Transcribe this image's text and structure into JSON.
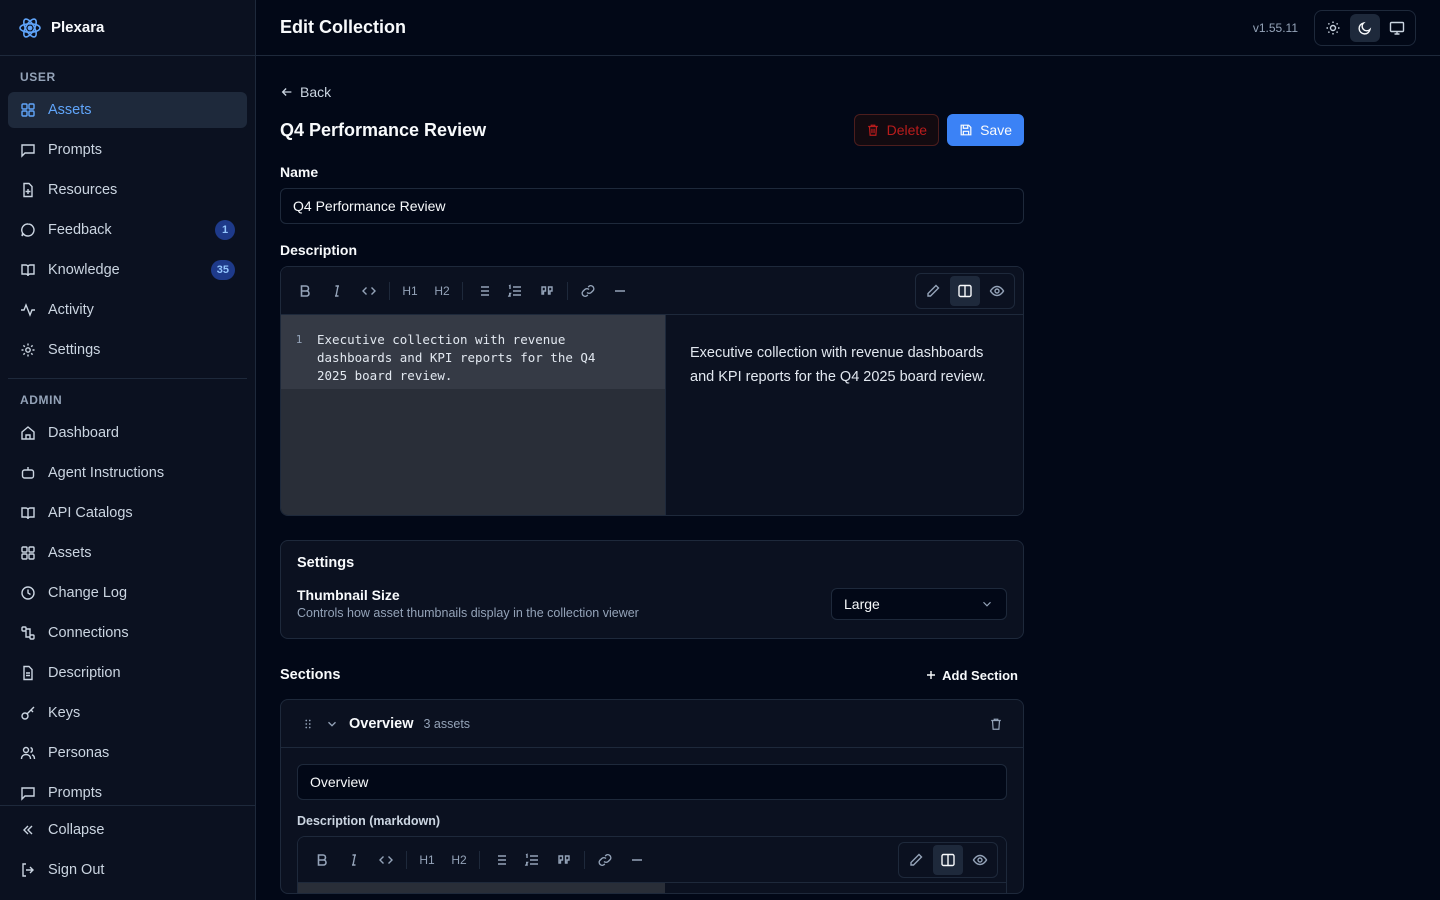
{
  "brand": {
    "name": "Plexara"
  },
  "sidebar": {
    "user_group": "USER",
    "user_items": [
      {
        "label": "Assets",
        "icon": "grid-icon",
        "active": true
      },
      {
        "label": "Prompts",
        "icon": "message-icon"
      },
      {
        "label": "Resources",
        "icon": "file-plus-icon"
      },
      {
        "label": "Feedback",
        "icon": "chat-icon",
        "badge": "1"
      },
      {
        "label": "Knowledge",
        "icon": "book-icon",
        "badge": "35"
      },
      {
        "label": "Activity",
        "icon": "activity-icon"
      },
      {
        "label": "Settings",
        "icon": "gear-icon"
      }
    ],
    "admin_group": "ADMIN",
    "admin_items": [
      {
        "label": "Dashboard",
        "icon": "home-icon"
      },
      {
        "label": "Agent Instructions",
        "icon": "bot-icon"
      },
      {
        "label": "API Catalogs",
        "icon": "book-icon"
      },
      {
        "label": "Assets",
        "icon": "grid-icon"
      },
      {
        "label": "Change Log",
        "icon": "clock-icon"
      },
      {
        "label": "Connections",
        "icon": "connection-icon"
      },
      {
        "label": "Description",
        "icon": "doc-icon"
      },
      {
        "label": "Keys",
        "icon": "key-icon"
      },
      {
        "label": "Personas",
        "icon": "users-icon"
      },
      {
        "label": "Prompts",
        "icon": "message-icon"
      }
    ],
    "footer": {
      "collapse": "Collapse",
      "sign_out": "Sign Out"
    }
  },
  "topbar": {
    "title": "Edit Collection",
    "version": "v1.55.11"
  },
  "page": {
    "back": "Back",
    "title": "Q4 Performance Review",
    "delete": "Delete",
    "save": "Save"
  },
  "form": {
    "name_label": "Name",
    "name_value": "Q4 Performance Review",
    "description_label": "Description",
    "line_number": "1",
    "description_text": "Executive collection with revenue dashboards and KPI reports for the Q4 2025 board review.",
    "description_preview": "Executive collection with revenue dashboards and KPI reports for the Q4 2025 board review."
  },
  "toolbar": {
    "h1": "H1",
    "h2": "H2"
  },
  "settings": {
    "title": "Settings",
    "thumb_label": "Thumbnail Size",
    "thumb_desc": "Controls how asset thumbnails display in the collection viewer",
    "thumb_value": "Large"
  },
  "sections": {
    "title": "Sections",
    "add": "Add Section",
    "items": [
      {
        "name": "Overview",
        "count": "3 assets",
        "name_value": "Overview",
        "desc_label": "Description (markdown)"
      }
    ]
  },
  "colors": {
    "accent": "#3b82f6",
    "danger": "#b91c1c",
    "background": "#020817"
  }
}
